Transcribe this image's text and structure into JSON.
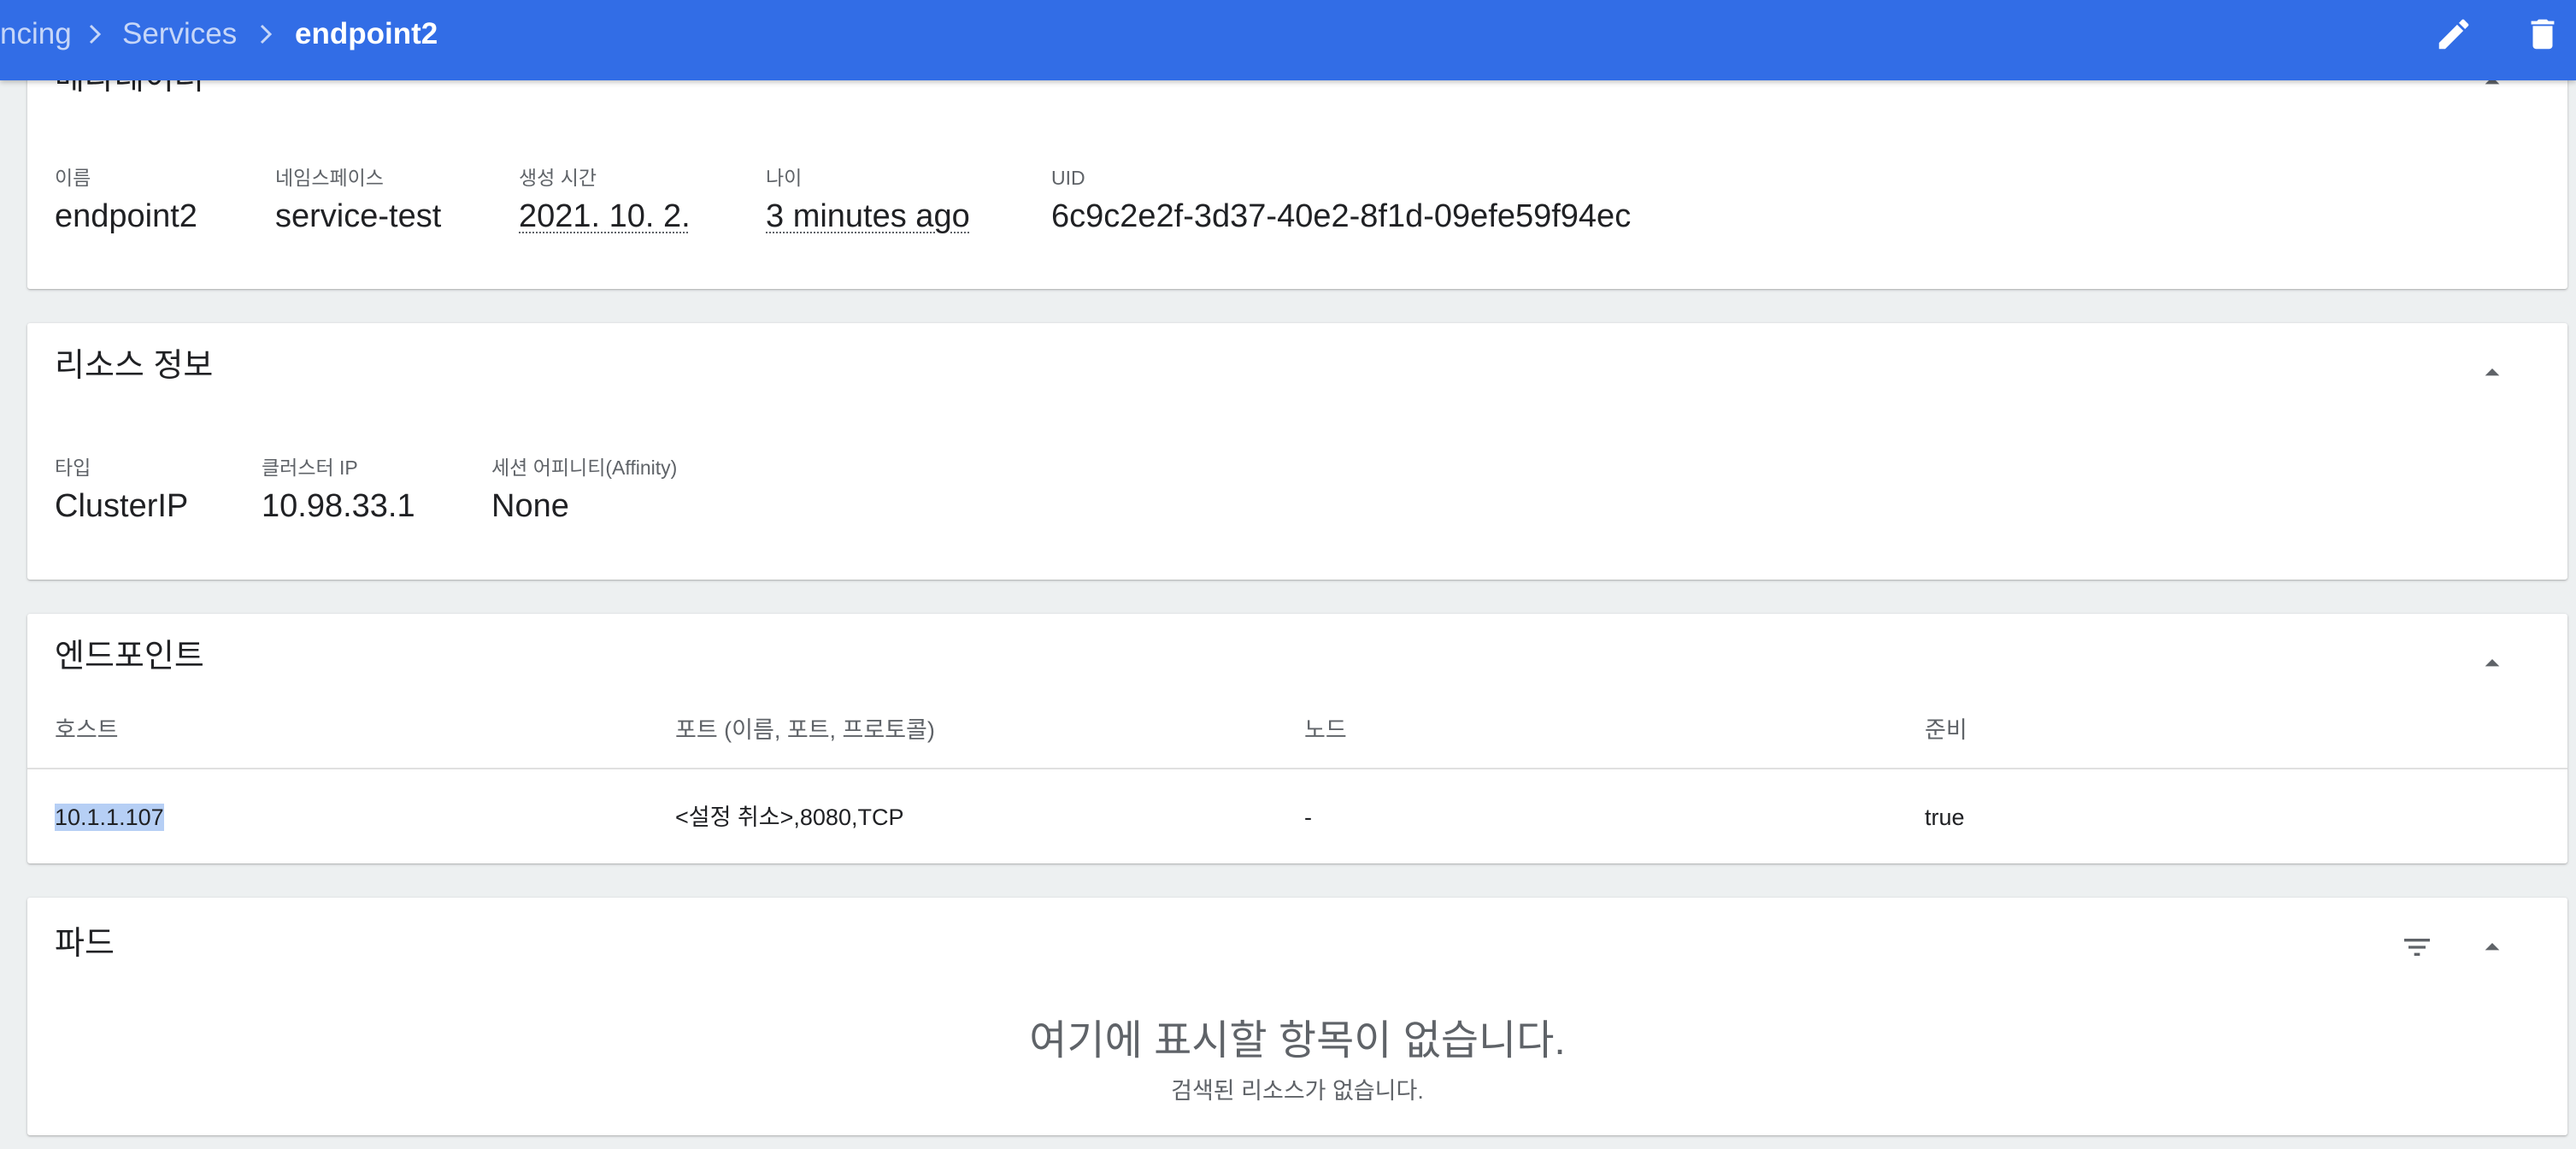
{
  "header": {
    "breadcrumb": [
      "ncing",
      "Services",
      "endpoint2"
    ],
    "actions": [
      {
        "icon": "edit-icon"
      },
      {
        "icon": "delete-icon"
      }
    ],
    "colors": {
      "bar": "#326de6"
    }
  },
  "metadata": {
    "title": "메타데이터",
    "fields": [
      {
        "label": "이름",
        "value": "endpoint2"
      },
      {
        "label": "네임스페이스",
        "value": "service-test"
      },
      {
        "label": "생성 시간",
        "value": "2021. 10. 2."
      },
      {
        "label": "나이",
        "value": "3 minutes ago"
      },
      {
        "label": "UID",
        "value": "6c9c2e2f-3d37-40e2-8f1d-09efe59f94ec"
      }
    ]
  },
  "resource_info": {
    "title": "리소스 정보",
    "fields": [
      {
        "label": "타입",
        "value": "ClusterIP"
      },
      {
        "label": "클러스터 IP",
        "value": "10.98.33.1"
      },
      {
        "label": "세션 어피니티(Affinity)",
        "value": "None"
      }
    ]
  },
  "endpoints": {
    "title": "엔드포인트",
    "columns": [
      "호스트",
      "포트 (이름, 포트, 프로토콜)",
      "노드",
      "준비"
    ],
    "rows": [
      [
        "10.1.1.107",
        "<설정 취소>,8080,TCP",
        "-",
        "true"
      ]
    ]
  },
  "pods": {
    "title": "파드",
    "empty_title": "여기에 표시할 항목이 없습니다.",
    "empty_subtitle": "검색된 리소스가 없습니다."
  }
}
